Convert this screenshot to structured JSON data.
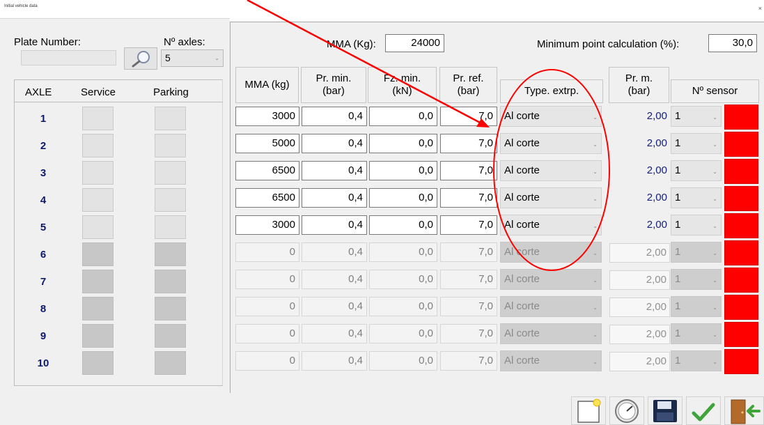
{
  "window": {
    "title": "Initial vehicle data",
    "close": "×"
  },
  "left": {
    "plate_label": "Plate Number:",
    "plate_value": "",
    "axles_label": "Nº axles:",
    "axles_value": "5",
    "headers": {
      "axle": "AXLE",
      "service": "Service",
      "parking": "Parking"
    }
  },
  "top": {
    "mma_label": "MMA (Kg):",
    "mma_value": "24000",
    "minpt_label": "Minimum point calculation (%):",
    "minpt_value": "30,0"
  },
  "columns": {
    "mma": "MMA (kg)",
    "prmin": "Pr. min. (bar)",
    "fzmin": "Fz. min. (kN)",
    "prref": "Pr. ref. (bar)",
    "type": "Type. extrp.",
    "prm": "Pr. m. (bar)",
    "sensor": "Nº sensor"
  },
  "rows": [
    {
      "axle": "1",
      "mma": "3000",
      "prmin": "0,4",
      "fzmin": "0,0",
      "prref": "7,0",
      "type": "Al corte",
      "prm": "2,00",
      "sensor": "1",
      "active": true
    },
    {
      "axle": "2",
      "mma": "5000",
      "prmin": "0,4",
      "fzmin": "0,0",
      "prref": "7,0",
      "type": "Al corte",
      "prm": "2,00",
      "sensor": "1",
      "active": true
    },
    {
      "axle": "3",
      "mma": "6500",
      "prmin": "0,4",
      "fzmin": "0,0",
      "prref": "7,0",
      "type": "Al corte",
      "prm": "2,00",
      "sensor": "1",
      "active": true
    },
    {
      "axle": "4",
      "mma": "6500",
      "prmin": "0,4",
      "fzmin": "0,0",
      "prref": "7,0",
      "type": "Al corte",
      "prm": "2,00",
      "sensor": "1",
      "active": true
    },
    {
      "axle": "5",
      "mma": "3000",
      "prmin": "0,4",
      "fzmin": "0,0",
      "prref": "7,0",
      "type": "Al corte",
      "prm": "2,00",
      "sensor": "1",
      "active": true
    },
    {
      "axle": "6",
      "mma": "0",
      "prmin": "0,4",
      "fzmin": "0,0",
      "prref": "7,0",
      "type": "Al corte",
      "prm": "2,00",
      "sensor": "1",
      "active": false
    },
    {
      "axle": "7",
      "mma": "0",
      "prmin": "0,4",
      "fzmin": "0,0",
      "prref": "7,0",
      "type": "Al corte",
      "prm": "2,00",
      "sensor": "1",
      "active": false
    },
    {
      "axle": "8",
      "mma": "0",
      "prmin": "0,4",
      "fzmin": "0,0",
      "prref": "7,0",
      "type": "Al corte",
      "prm": "2,00",
      "sensor": "1",
      "active": false
    },
    {
      "axle": "9",
      "mma": "0",
      "prmin": "0,4",
      "fzmin": "0,0",
      "prref": "7,0",
      "type": "Al corte",
      "prm": "2,00",
      "sensor": "1",
      "active": false
    },
    {
      "axle": "10",
      "mma": "0",
      "prmin": "0,4",
      "fzmin": "0,0",
      "prref": "7,0",
      "type": "Al corte",
      "prm": "2,00",
      "sensor": "1",
      "active": false
    }
  ],
  "status_color": "#ff0000",
  "toolbar": [
    {
      "icon": "new-document-icon"
    },
    {
      "icon": "pressure-gauge-icon"
    },
    {
      "icon": "save-disk-icon"
    },
    {
      "icon": "checkmark-icon"
    },
    {
      "icon": "exit-door-icon"
    }
  ],
  "annotation": {
    "color": "#ff0000"
  }
}
